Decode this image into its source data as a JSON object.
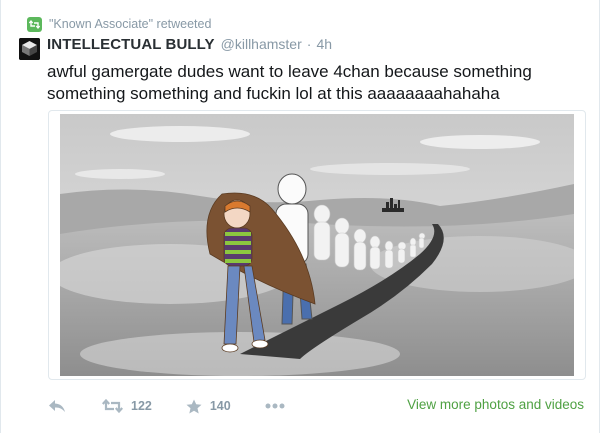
{
  "retweet": {
    "icon": "retweet-icon",
    "text": "\"Known Associate\" retweeted"
  },
  "tweet": {
    "display_name": "INTELLECTUAL BULLY",
    "handle": "@killhamster",
    "separator": "·",
    "time": "4h",
    "text": "awful gamergate dudes want to leave 4chan because something something something and fuckin lol at this aaaaaaaahahaha"
  },
  "actions": {
    "reply_icon": "reply-icon",
    "retweet_icon": "retweet-icon",
    "retweet_count": "122",
    "favorite_icon": "star-icon",
    "favorite_count": "140",
    "more_icon": "more-dots-icon",
    "view_more_label": "View more photos and videos"
  },
  "colors": {
    "link_green": "#4fa143",
    "retweet_green": "#5cb85c",
    "muted": "#8899a6"
  }
}
